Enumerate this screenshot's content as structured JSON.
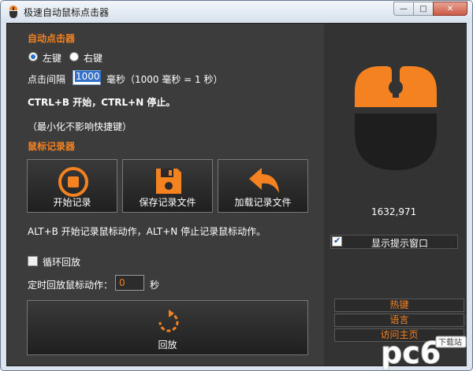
{
  "window": {
    "title": "极速自动鼠标点击器",
    "close_glyph": "✕",
    "max_glyph": "□",
    "min_glyph": "—"
  },
  "auto_clicker": {
    "title": "自动点击器",
    "left_label": "左键",
    "right_label": "右键",
    "interval_label": "点击间隔",
    "interval_value": "1000",
    "interval_unit": "毫秒（1000 毫秒 = 1 秒）",
    "shortcut_text": "CTRL+B 开始，CTRL+N 停止。",
    "minimize_note": "（最小化不影响快捷键）"
  },
  "recorder": {
    "title": "鼠标记录器",
    "start_label": "开始记录",
    "save_label": "保存记录文件",
    "load_label": "加载记录文件",
    "shortcut_text": "ALT+B 开始记录鼠标动作，ALT+N 停止记录鼠标动作。",
    "loop_label": "循环回放",
    "timer_label": "定时回放鼠标动作：",
    "timer_value": "0",
    "timer_unit": "秒",
    "play_label": "回放"
  },
  "side": {
    "coords": "1632,971",
    "show_tip_label": "显示提示窗口",
    "links": [
      "热键",
      "语言",
      "访问主页"
    ]
  },
  "colors": {
    "accent": "#f58220",
    "panel": "#3c3c3c",
    "side_panel": "#333333"
  },
  "icons": {
    "app": "mouse-icon",
    "record": "record-icon",
    "save": "floppy-disk-icon",
    "load": "reply-arrow-icon",
    "replay": "replay-icon",
    "mouse": "mouse-icon"
  },
  "watermark": {
    "text": "pc6",
    "badge": "下载站"
  }
}
